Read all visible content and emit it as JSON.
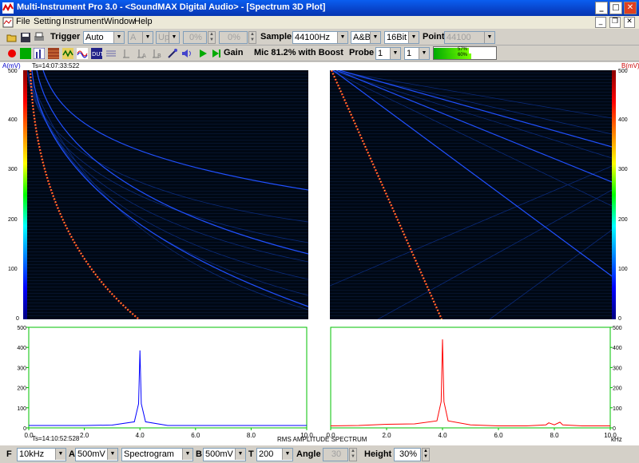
{
  "window": {
    "title": "Multi-Instrument Pro 3.0 - <SoundMAX Digital Audio> - [Spectrum 3D Plot]"
  },
  "menu": [
    "File",
    "Setting",
    "Instrument",
    "Window",
    "Help"
  ],
  "toolbar1": {
    "trigger_label": "Trigger",
    "trigger_value": "Auto",
    "channel_value": "A",
    "slope_value": "Up",
    "level1": "0%",
    "level2": "0%",
    "sample_label": "Sample",
    "sample_value": "44100Hz",
    "channels_value": "A&B",
    "bits_value": "16Bit",
    "point_label": "Point",
    "point_value": "44100"
  },
  "toolbar2": {
    "gain_label": "Gain",
    "mic_text": "Mic 81.2% with Boost",
    "probe_label": "Probe",
    "probe_a": "1",
    "probe_b": "1",
    "meter_top": "57%",
    "meter_bottom": "60%"
  },
  "left_panel": {
    "axis_title": "A(mV)",
    "timestamp_top": "Ts=14:07:33:522",
    "timestamp_bottom": "Ts=14:10:52:528",
    "y_ticks": [
      "500",
      "400",
      "300",
      "200",
      "100",
      "0"
    ],
    "x_ticks": [
      "0.0",
      "2.0",
      "4.0",
      "6.0",
      "8.0",
      "10.0"
    ]
  },
  "right_panel": {
    "axis_title": "B(mV)",
    "y_ticks": [
      "500",
      "400",
      "300",
      "200",
      "100",
      "0"
    ],
    "x_ticks": [
      "0.0",
      "2.0",
      "4.0",
      "6.0",
      "8.0",
      "10.0"
    ],
    "x_unit": "kHz"
  },
  "footer_title": "RMS AMPLITUDE SPECTRUM",
  "bottombar": {
    "f_label": "F",
    "f_value": "10kHz",
    "a_label": "A",
    "a_value": "500mV",
    "mode_value": "Spectrogram",
    "b_label": "B",
    "b_value": "500mV",
    "t_label": "T",
    "t_value": "200",
    "angle_label": "Angle",
    "angle_value": "30",
    "height_label": "Height",
    "height_value": "30%"
  },
  "colors": {
    "titlebar": "#0843c9",
    "chA": "#0000ff",
    "chB": "#ff0000",
    "grid_border": "#00c000"
  },
  "chart_data": [
    {
      "type": "line",
      "name": "Channel A spectrum",
      "x": [
        0,
        1,
        2,
        3,
        3.8,
        3.95,
        4.0,
        4.05,
        4.2,
        5,
        6,
        7,
        8,
        9,
        10
      ],
      "values": [
        12,
        12,
        12,
        14,
        30,
        120,
        385,
        120,
        30,
        12,
        12,
        12,
        12,
        12,
        12
      ],
      "xlim": [
        0,
        10
      ],
      "ylim": [
        0,
        500
      ]
    },
    {
      "type": "line",
      "name": "Channel B spectrum",
      "x": [
        0,
        1,
        2,
        3,
        3.8,
        3.95,
        4.0,
        4.05,
        4.2,
        5,
        6,
        7,
        7.7,
        7.8,
        8.0,
        8.2,
        8.3,
        9,
        10
      ],
      "values": [
        10,
        12,
        18,
        20,
        35,
        130,
        440,
        130,
        35,
        15,
        10,
        10,
        15,
        25,
        15,
        28,
        15,
        10,
        10
      ],
      "xlim": [
        0,
        10
      ],
      "ylim": [
        0,
        500
      ]
    }
  ]
}
